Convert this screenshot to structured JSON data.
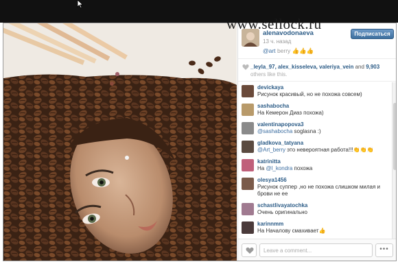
{
  "watermark": "www.sellock.ru",
  "post": {
    "username": "alenavodonaeva",
    "time": "13 ч. назад",
    "caption_mention": "@art",
    "caption_text": "berry 👍👍👍",
    "follow_label": "Подписаться"
  },
  "likes": {
    "names": "_leyla_97, alex_kisseleva, valeriya_vein",
    "and": "and",
    "count": "9,903",
    "rest": "others like this."
  },
  "comments": [
    {
      "user": "devickaya",
      "text": "Рисунок красивый, но не похожа совсем)",
      "avatar_color": "#6a4a3a"
    },
    {
      "user": "sashabocha",
      "text": "На Кемерон Диаз похожа)",
      "avatar_color": "#b89a6a"
    },
    {
      "user": "valentinapopova3",
      "mention": "@sashabocha",
      "text": "soglasna :)",
      "avatar_color": "#8a8a8a"
    },
    {
      "user": "gladkova_tatyana",
      "mention": "@Art_berry",
      "text": "это невероятная работа!!!👏👏👏",
      "avatar_color": "#5a4a40"
    },
    {
      "user": "katrinitta",
      "pre": "На",
      "mention": "@l_kondra",
      "text": "похожа",
      "avatar_color": "#c0607a"
    },
    {
      "user": "olesya1456",
      "text": "Рисунок суппер ,но не похожа слишком милая и брови не ее",
      "avatar_color": "#7a5a4a"
    },
    {
      "user": "schastlivayatochka",
      "text": "Очень оригинально",
      "avatar_color": "#a07a90"
    },
    {
      "user": "karinnmm",
      "text": "На Началову смахивает👍",
      "avatar_color": "#4a3a3a"
    }
  ],
  "footer": {
    "comment_placeholder": "Leave a comment...",
    "more_label": "•••"
  },
  "colors": {
    "link": "#2b5b86",
    "follow_button": "#3d6f9e",
    "topbar": "#111111"
  }
}
